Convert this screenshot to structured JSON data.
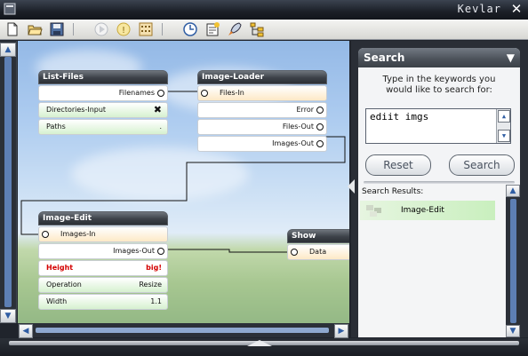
{
  "window": {
    "title": "Kevlar",
    "close_glyph": "✕"
  },
  "toolbar": {
    "buttons": [
      {
        "name": "new-file-icon"
      },
      {
        "name": "open-folder-icon"
      },
      {
        "name": "save-disk-icon"
      },
      {
        "name": "play-icon"
      },
      {
        "name": "info-icon"
      },
      {
        "name": "grid-icon"
      },
      {
        "name": "clock-icon"
      },
      {
        "name": "note-icon"
      },
      {
        "name": "rocket-icon"
      },
      {
        "name": "tree-icon"
      }
    ]
  },
  "nodes": {
    "list_files": {
      "title": "List-Files",
      "ports": [
        {
          "label": "Filenames"
        },
        {
          "label": "Directories-Input",
          "value": "✖"
        },
        {
          "label": "Paths",
          "value": "."
        }
      ]
    },
    "image_loader": {
      "title": "Image-Loader",
      "ports": [
        {
          "label": "Files-In"
        },
        {
          "label": "Error"
        },
        {
          "label": "Files-Out"
        },
        {
          "label": "Images-Out"
        }
      ]
    },
    "image_edit": {
      "title": "Image-Edit",
      "ports": [
        {
          "label": "Images-In"
        },
        {
          "label": "Images-Out"
        },
        {
          "label": "Height",
          "value": "big!"
        },
        {
          "label": "Operation",
          "value": "Resize"
        },
        {
          "label": "Width",
          "value": "1.1"
        }
      ]
    },
    "show": {
      "title": "Show",
      "ports": [
        {
          "label": "Data"
        }
      ]
    }
  },
  "search": {
    "title": "Search",
    "chevron": "▼",
    "hint": "Type in the keywords you would like to search for:",
    "query": "ediit imgs",
    "reset_label": "Reset",
    "search_label": "Search",
    "results_header": "Search Results:",
    "results": [
      {
        "label": "Image-Edit"
      }
    ]
  },
  "colors": {
    "required_param": "#d40000",
    "input_port": "#fde9c6",
    "optional_param": "#d6f1cf"
  }
}
